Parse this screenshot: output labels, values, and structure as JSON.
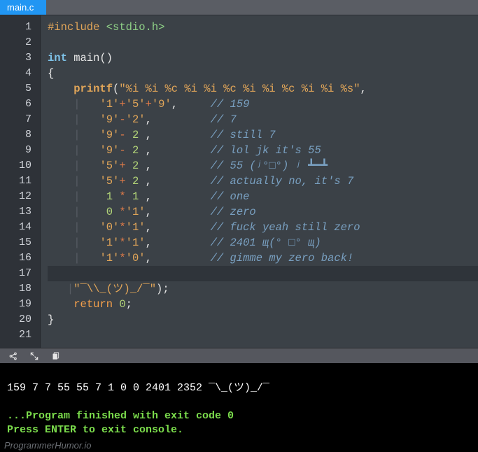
{
  "tab": {
    "label": "main.c"
  },
  "gutter": {
    "first": 1,
    "last": 21
  },
  "code": {
    "l1_include": "#include ",
    "l1_header": "<stdio.h>",
    "l3_int": "int",
    "l3_main": " main()",
    "l4_brace": "{",
    "l5_printf": "printf",
    "l5_open": "(",
    "l5_fmt": "\"%i %i %c %i %i %c %i %i %c %i %i %s\"",
    "l5_comma": ",",
    "rows": [
      {
        "arg_raw": "'1'+'5'+'9',",
        "cmt": "// 159"
      },
      {
        "arg_raw": "'9'-'2',",
        "cmt": "// 7"
      },
      {
        "arg_raw": "'9'- 2 ,",
        "cmt": "// still 7"
      },
      {
        "arg_raw": "'9'- 2 ,",
        "cmt": "// lol jk it's 55"
      },
      {
        "arg_raw": "'5'+ 2 ,",
        "cmt": "// 55 (ʲ°□°) ʲ ┻━┻"
      },
      {
        "arg_raw": "'5'+ 2 ,",
        "cmt": "// actually no, it's 7"
      },
      {
        "arg_raw": " 1 * 1 ,",
        "cmt": "// one"
      },
      {
        "arg_raw": " 0 *'1',",
        "cmt": "// zero"
      },
      {
        "arg_raw": "'0'*'1',",
        "cmt": "// fuck yeah still zero"
      },
      {
        "arg_raw": "'1'*'1',",
        "cmt": "// 2401 щ(° □° щ)"
      },
      {
        "arg_raw": "'1'*'0',",
        "cmt": "// gimme my zero back!"
      }
    ],
    "l17_shrug": "\"‾\\\\_(ツ)_/‾\"",
    "l17_close": ");",
    "l19_return": "return",
    "l19_zero": " 0",
    "l19_semi": ";",
    "l20_brace": "}"
  },
  "terminal": {
    "output": "159 7 7 55 55 7 1 0 0 2401 2352 ‾\\_(ツ)_/‾",
    "finished": "...Program finished with exit code 0",
    "prompt": "Press ENTER to exit console."
  },
  "watermark": "ProgrammerHumor.io"
}
